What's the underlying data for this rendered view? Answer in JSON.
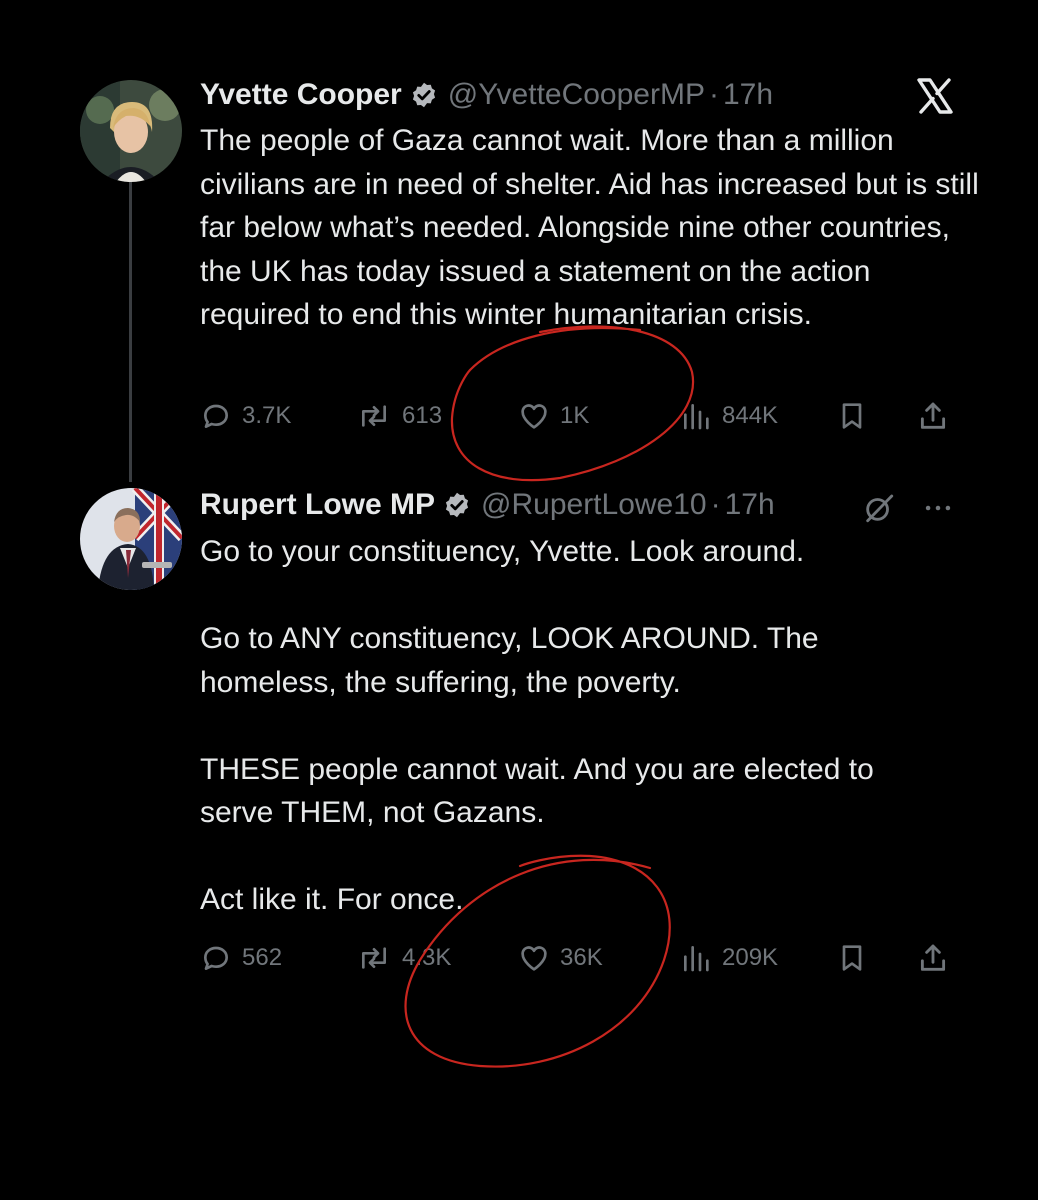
{
  "tweets": [
    {
      "author_name": "Yvette Cooper",
      "handle": "@YvetteCooperMP",
      "separator": "·",
      "time": "17h",
      "paragraphs": [
        "The people of Gaza cannot wait. More than a million civilians are in need of shelter. Aid has increased but is still far below what’s needed. Alongside nine other countries, the UK has today issued a statement on the action required to end this winter humanitarian crisis."
      ],
      "replies": "3.7K",
      "reposts": "613",
      "likes": "1K",
      "views": "844K"
    },
    {
      "author_name": "Rupert Lowe MP",
      "handle": "@RupertLowe10",
      "separator": "·",
      "time": "17h",
      "paragraphs": [
        "Go to your constituency, Yvette. Look around.",
        "Go to ANY constituency, LOOK AROUND. The homeless, the suffering, the poverty.",
        "THESE people cannot wait. And you are elected to serve THEM, not Gazans.",
        "Act like it. For once."
      ],
      "replies": "562",
      "reposts": "4.3K",
      "likes": "36K",
      "views": "209K"
    }
  ],
  "icons": {
    "verified": "verified-badge-icon",
    "reply": "reply-icon",
    "repost": "repost-icon",
    "like": "heart-icon",
    "views": "views-chart-icon",
    "bookmark": "bookmark-icon",
    "share": "share-icon",
    "x_logo": "x-logo-icon",
    "grok": "grok-icon",
    "more": "more-icon"
  },
  "colors": {
    "background": "#000000",
    "text": "#e7e9ea",
    "muted": "#71767b",
    "annotation": "#c8261f"
  }
}
